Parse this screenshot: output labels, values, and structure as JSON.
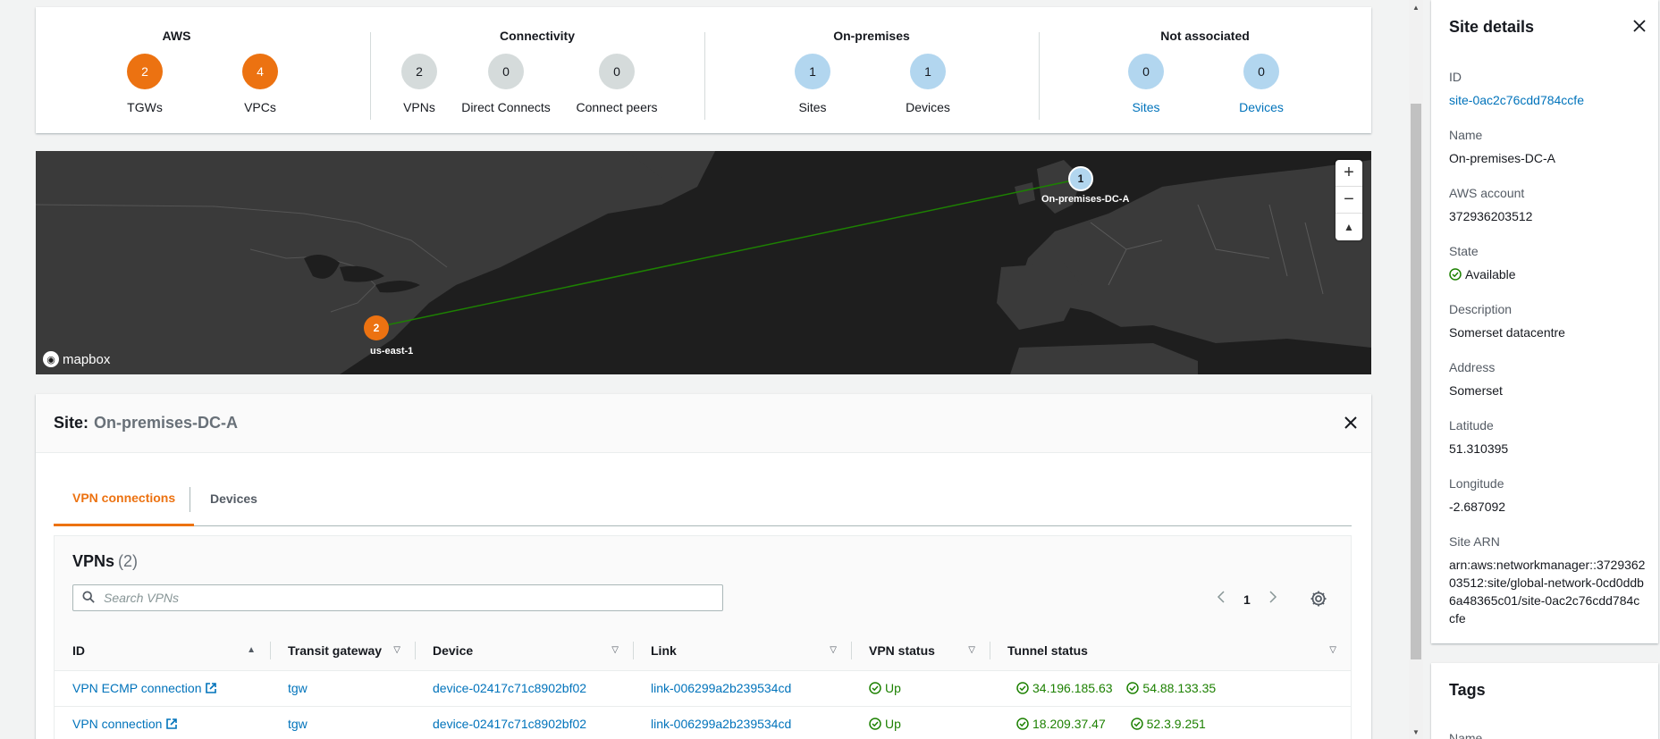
{
  "summary": {
    "groups": [
      {
        "title": "AWS",
        "stats": [
          {
            "value": "2",
            "label": "TGWs",
            "style": "orange"
          },
          {
            "value": "4",
            "label": "VPCs",
            "style": "orange"
          }
        ]
      },
      {
        "title": "Connectivity",
        "stats": [
          {
            "value": "2",
            "label": "VPNs",
            "style": "grey"
          },
          {
            "value": "0",
            "label": "Direct Connects",
            "style": "grey"
          },
          {
            "value": "0",
            "label": "Connect peers",
            "style": "grey"
          }
        ]
      },
      {
        "title": "On-premises",
        "stats": [
          {
            "value": "1",
            "label": "Sites",
            "style": "blue"
          },
          {
            "value": "1",
            "label": "Devices",
            "style": "blue"
          }
        ]
      },
      {
        "title": "Not associated",
        "stats": [
          {
            "value": "0",
            "label": "Sites",
            "style": "blue"
          },
          {
            "value": "0",
            "label": "Devices",
            "style": "blue"
          }
        ]
      }
    ]
  },
  "map": {
    "markers": [
      {
        "value": "1",
        "label": "On-premises-DC-A"
      },
      {
        "value": "2",
        "label": "us-east-1"
      }
    ],
    "zoom_in": "+",
    "zoom_out": "−",
    "compass": "▲",
    "attribution": "mapbox",
    "link_color": "#1d8102"
  },
  "site": {
    "label": "Site:",
    "name": "On-premises-DC-A",
    "tabs": [
      {
        "label": "VPN connections",
        "active": true
      },
      {
        "label": "Devices",
        "active": false
      }
    ]
  },
  "vpns": {
    "title": "VPNs",
    "count": "(2)",
    "search_placeholder": "Search VPNs",
    "page": "1",
    "columns": [
      "ID",
      "Transit gateway",
      "Device",
      "Link",
      "VPN status",
      "Tunnel status"
    ],
    "rows": [
      {
        "id": "VPN ECMP connection",
        "tgw": "tgw",
        "device": "device-02417c71c8902bf02",
        "link": "link-006299a2b239534cd",
        "status": "Up",
        "tunnels": [
          "34.196.185.63",
          "54.88.133.35"
        ]
      },
      {
        "id": "VPN connection",
        "tgw": "tgw",
        "device": "device-02417c71c8902bf02",
        "link": "link-006299a2b239534cd",
        "status": "Up",
        "tunnels": [
          "18.209.37.47",
          "52.3.9.251"
        ]
      }
    ]
  },
  "details": {
    "title": "Site details",
    "fields": [
      {
        "label": "ID",
        "value": "site-0ac2c76cdd784ccfe",
        "link": true
      },
      {
        "label": "Name",
        "value": "On-premises-DC-A"
      },
      {
        "label": "AWS account",
        "value": "372936203512"
      },
      {
        "label": "State",
        "value": "Available",
        "status": true
      },
      {
        "label": "Description",
        "value": "Somerset datacentre"
      },
      {
        "label": "Address",
        "value": "Somerset"
      },
      {
        "label": "Latitude",
        "value": "51.310395"
      },
      {
        "label": "Longitude",
        "value": "-2.687092"
      },
      {
        "label": "Site ARN",
        "value": "arn:aws:networkmanager::372936203512:site/global-network-0cd0ddb6a48365c01/site-0ac2c76cdd784ccfe"
      }
    ]
  },
  "tags": {
    "title": "Tags",
    "name_header": "Name"
  },
  "colors": {
    "accent": "#ec7211",
    "link": "#0073bb",
    "success": "#1d8102"
  }
}
